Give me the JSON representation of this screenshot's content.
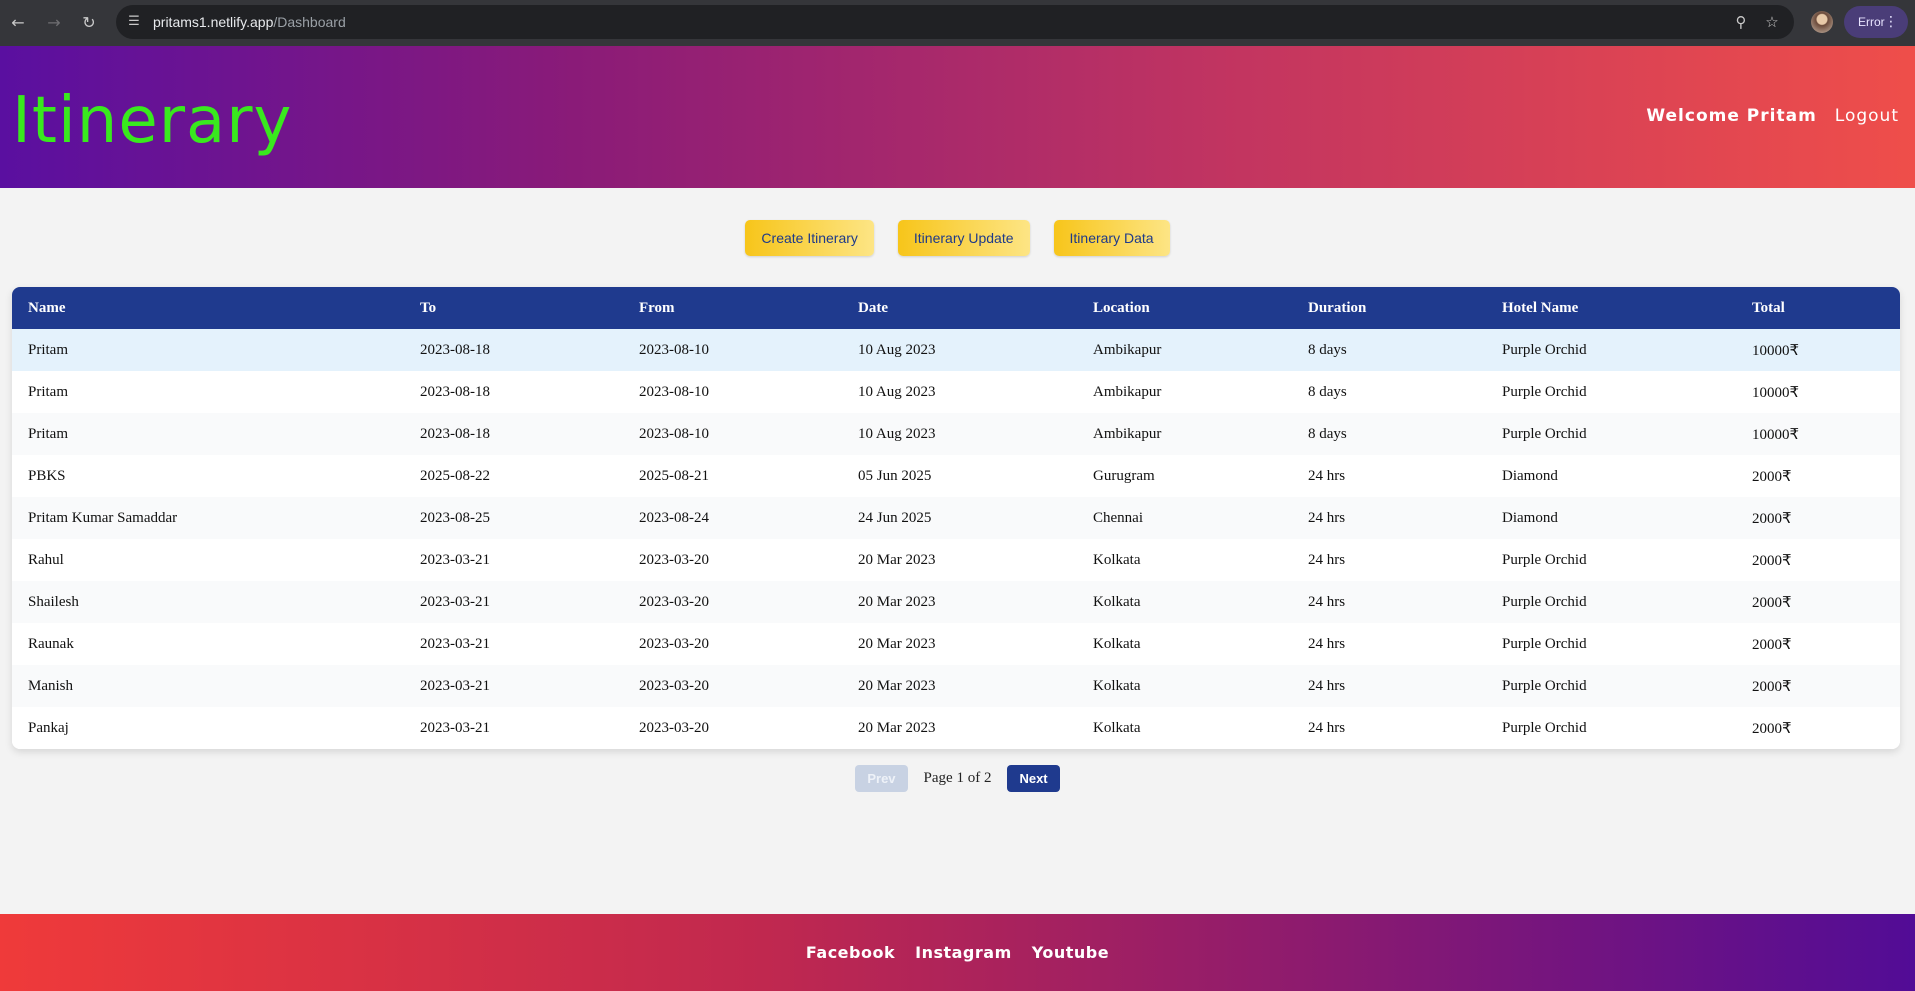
{
  "browser": {
    "url_host": "pritams1.netlify.app",
    "url_path": "/Dashboard",
    "profile_status": "Error"
  },
  "header": {
    "brand": "Itinerary",
    "welcome": "Welcome Pritam",
    "logout": "Logout"
  },
  "actions": {
    "create": "Create Itinerary",
    "update": "Itinerary Update",
    "data": "Itinerary Data"
  },
  "table": {
    "columns": [
      "Name",
      "To",
      "From",
      "Date",
      "Location",
      "Duration",
      "Hotel Name",
      "Total"
    ],
    "rows": [
      [
        "Pritam",
        "2023-08-18",
        "2023-08-10",
        "10 Aug 2023",
        "Ambikapur",
        "8 days",
        "Purple Orchid",
        "10000₹"
      ],
      [
        "Pritam",
        "2023-08-18",
        "2023-08-10",
        "10 Aug 2023",
        "Ambikapur",
        "8 days",
        "Purple Orchid",
        "10000₹"
      ],
      [
        "Pritam",
        "2023-08-18",
        "2023-08-10",
        "10 Aug 2023",
        "Ambikapur",
        "8 days",
        "Purple Orchid",
        "10000₹"
      ],
      [
        "PBKS",
        "2025-08-22",
        "2025-08-21",
        "05 Jun 2025",
        "Gurugram",
        "24 hrs",
        "Diamond",
        "2000₹"
      ],
      [
        "Pritam Kumar Samaddar",
        "2023-08-25",
        "2023-08-24",
        "24 Jun 2025",
        "Chennai",
        "24 hrs",
        "Diamond",
        "2000₹"
      ],
      [
        "Rahul",
        "2023-03-21",
        "2023-03-20",
        "20 Mar 2023",
        "Kolkata",
        "24 hrs",
        "Purple Orchid",
        "2000₹"
      ],
      [
        "Shailesh",
        "2023-03-21",
        "2023-03-20",
        "20 Mar 2023",
        "Kolkata",
        "24 hrs",
        "Purple Orchid",
        "2000₹"
      ],
      [
        "Raunak",
        "2023-03-21",
        "2023-03-20",
        "20 Mar 2023",
        "Kolkata",
        "24 hrs",
        "Purple Orchid",
        "2000₹"
      ],
      [
        "Manish",
        "2023-03-21",
        "2023-03-20",
        "20 Mar 2023",
        "Kolkata",
        "24 hrs",
        "Purple Orchid",
        "2000₹"
      ],
      [
        "Pankaj",
        "2023-03-21",
        "2023-03-20",
        "20 Mar 2023",
        "Kolkata",
        "24 hrs",
        "Purple Orchid",
        "2000₹"
      ]
    ]
  },
  "pagination": {
    "prev": "Prev",
    "info": "Page 1 of 2",
    "next": "Next"
  },
  "footer": {
    "links": [
      "Facebook",
      "Instagram",
      "Youtube"
    ]
  },
  "colors": {
    "brand_text": "#39e91e",
    "table_header": "#1f3a8e",
    "button_yellow": "#f7c51a"
  }
}
